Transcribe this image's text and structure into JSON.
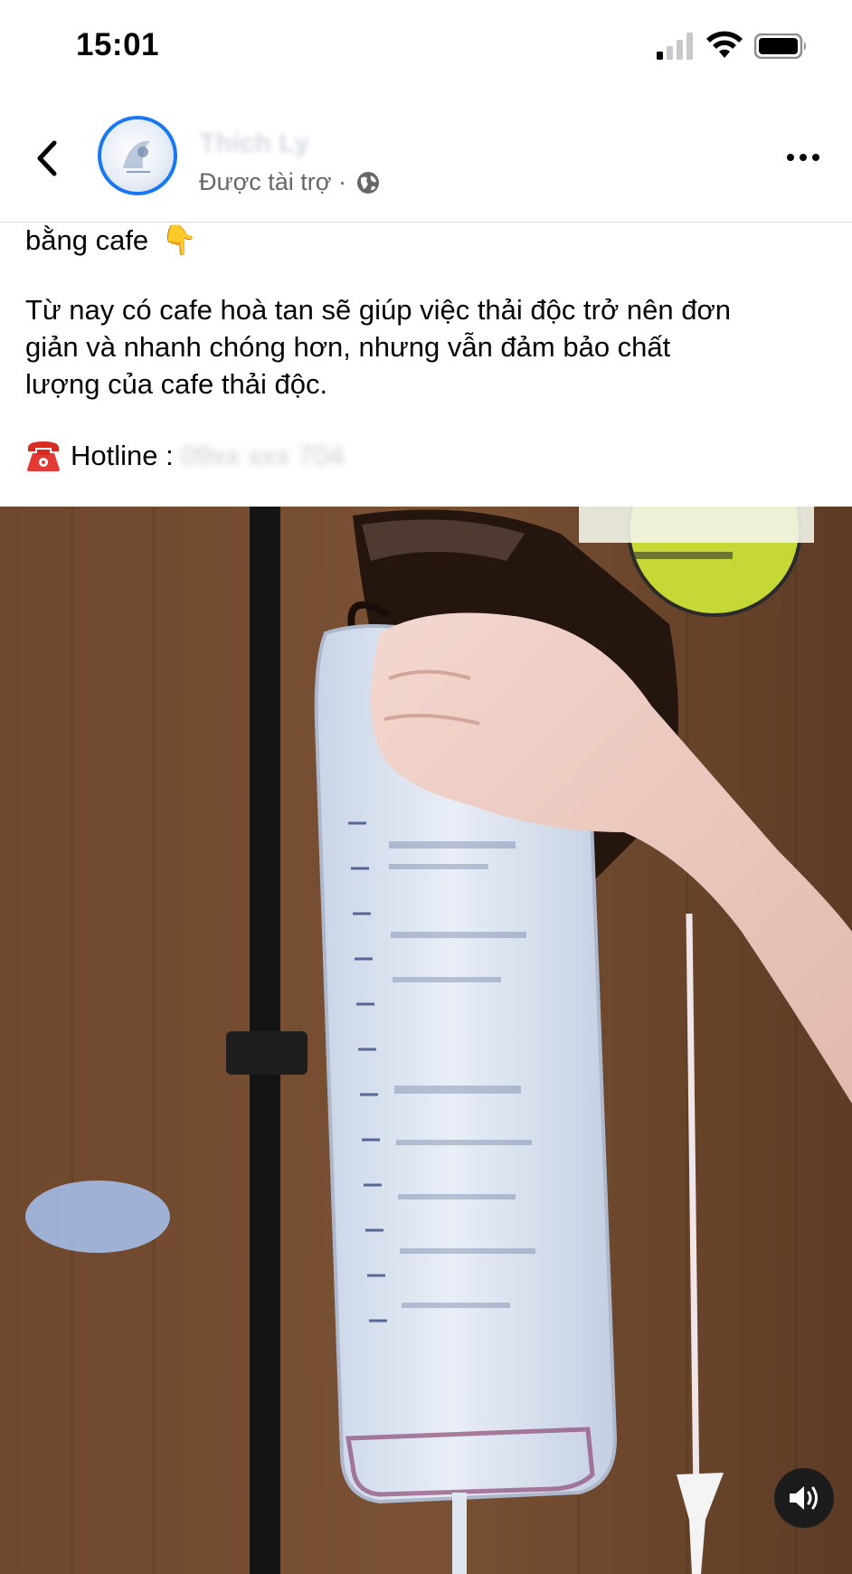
{
  "status_bar": {
    "time": "15:01",
    "icons": [
      "cellular-signal-icon",
      "wifi-icon",
      "battery-icon"
    ]
  },
  "header": {
    "back_icon": "chevron-left-icon",
    "page_name": "Thích Ly",
    "sponsored_label": "Được tài trợ ·",
    "privacy_icon": "globe-icon",
    "more_icon": "more-dots-icon"
  },
  "post": {
    "line_top": "bằng cafe",
    "pointing_emoji": "👇",
    "paragraph_lines": [
      "Từ nay có cafe hoà tan sẽ giúp việc thải độc trở nên đơn",
      "giản và nhanh chóng hơn, nhưng vẫn đảm bảo chất",
      "lượng của cafe thải độc."
    ],
    "hotline_label": "Hotline :",
    "hotline_number": "09xx xxx 704"
  },
  "video": {
    "sound_icon": "speaker-volume-icon",
    "colors": {
      "wall": "#6b452c",
      "pole": "#121212",
      "bag": "#dde6f3",
      "coffee": "#2a1a14",
      "logo_badge": "#c6d836"
    }
  },
  "colors": {
    "accent": "#1877f2",
    "text_primary": "#050505",
    "text_secondary": "#65676b"
  }
}
